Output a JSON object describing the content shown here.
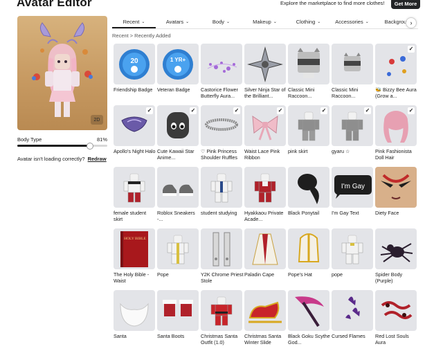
{
  "header": {
    "title": "Avatar Editor",
    "marketplace_text": "Explore the marketplace to find more clothes!",
    "get_more_label": "Get More"
  },
  "preview": {
    "badge_2d": "2D",
    "body_type_label": "Body Type",
    "body_type_value": "81%",
    "body_type_fraction": 0.81,
    "loading_text": "Avatar isn't loading correctly?",
    "redraw_label": "Redraw"
  },
  "tabs": [
    {
      "label": "Recent",
      "active": true
    },
    {
      "label": "Avatars",
      "active": false
    },
    {
      "label": "Body",
      "active": false
    },
    {
      "label": "Makeup",
      "active": false
    },
    {
      "label": "Clothing",
      "active": false
    },
    {
      "label": "Accessories",
      "active": false
    },
    {
      "label": "Backgrou",
      "active": false
    }
  ],
  "breadcrumb": {
    "root": "Recent",
    "separator": ">",
    "current": "Recently Added"
  },
  "items": [
    {
      "label": "Friendship Badge",
      "icon": "friendship-badge",
      "checked": false
    },
    {
      "label": "Veteran Badge",
      "icon": "veteran-badge",
      "checked": false
    },
    {
      "label": "Castorice Flower Butterfly Aura...",
      "icon": "butterfly-aura",
      "checked": false
    },
    {
      "label": "Silver Ninja Star of the Brilliant...",
      "icon": "ninja-star",
      "checked": false
    },
    {
      "label": "Classic Mini Raccoon...",
      "icon": "raccoon",
      "checked": false
    },
    {
      "label": "Classic Mini Raccoon...",
      "icon": "raccoon-small",
      "checked": false
    },
    {
      "label": "🐝 Bizzy Bee Aura (Grow a...",
      "icon": "bee-aura",
      "checked": true
    },
    {
      "label": "Apollo's Night Halo",
      "icon": "night-halo",
      "checked": true
    },
    {
      "label": "Cute Kawaii Star Anime...",
      "icon": "kawaii-face",
      "checked": true
    },
    {
      "label": "♡ Pink Princess Shoulder Ruffles",
      "icon": "shoulder-ruffles",
      "checked": true
    },
    {
      "label": "Waist Lace Pink Ribbon",
      "icon": "pink-ribbon",
      "checked": true
    },
    {
      "label": "pink skirt",
      "icon": "pink-skirt",
      "checked": true
    },
    {
      "label": "gyaru ☆",
      "icon": "gyaru",
      "checked": true
    },
    {
      "label": "Pink Fashionista Doll Hair",
      "icon": "pink-hair",
      "checked": true
    },
    {
      "label": "female student skirt",
      "icon": "student-skirt",
      "checked": false
    },
    {
      "label": "Roblox Sneakers -...",
      "icon": "sneakers",
      "checked": false
    },
    {
      "label": "student studying",
      "icon": "student-studying",
      "checked": false
    },
    {
      "label": "Hyakkaou Private Acade...",
      "icon": "academy-uniform",
      "checked": false
    },
    {
      "label": "Black Ponytail",
      "icon": "black-ponytail",
      "checked": false
    },
    {
      "label": "I'm Gay Text",
      "icon": "gay-text",
      "checked": false,
      "bubble_text": "I'm Gay"
    },
    {
      "label": "Diety Face",
      "icon": "diety-face",
      "checked": false
    },
    {
      "label": "The Holy Bible - Waist",
      "icon": "holy-bible",
      "checked": false,
      "book_text": "HOLY BIBLE"
    },
    {
      "label": "Pope",
      "icon": "pope",
      "checked": false
    },
    {
      "label": "Y2K Chrome Priest Stole",
      "icon": "priest-stole",
      "checked": false
    },
    {
      "label": "Paladin Cape",
      "icon": "paladin-cape",
      "checked": false
    },
    {
      "label": "Pope's Hat",
      "icon": "popes-hat",
      "checked": false
    },
    {
      "label": "pope",
      "icon": "pope-outfit",
      "checked": false
    },
    {
      "label": "Spider Body (Purple)",
      "icon": "spider",
      "checked": false
    },
    {
      "label": "Santa",
      "icon": "santa-beard",
      "checked": false
    },
    {
      "label": "Santa Boots",
      "icon": "santa-boots",
      "checked": false
    },
    {
      "label": "Christmas Santa Outfit (1.0)",
      "icon": "santa-outfit",
      "checked": false
    },
    {
      "label": "Christmas Santa Winter Slide",
      "icon": "santa-sleigh",
      "checked": false
    },
    {
      "label": "Black Goku Scythe God...",
      "icon": "scythe",
      "checked": false
    },
    {
      "label": "Cursed Flames",
      "icon": "cursed-flames",
      "checked": false
    },
    {
      "label": "Red Lost Souls Aura",
      "icon": "lost-souls-aura",
      "checked": false
    }
  ]
}
